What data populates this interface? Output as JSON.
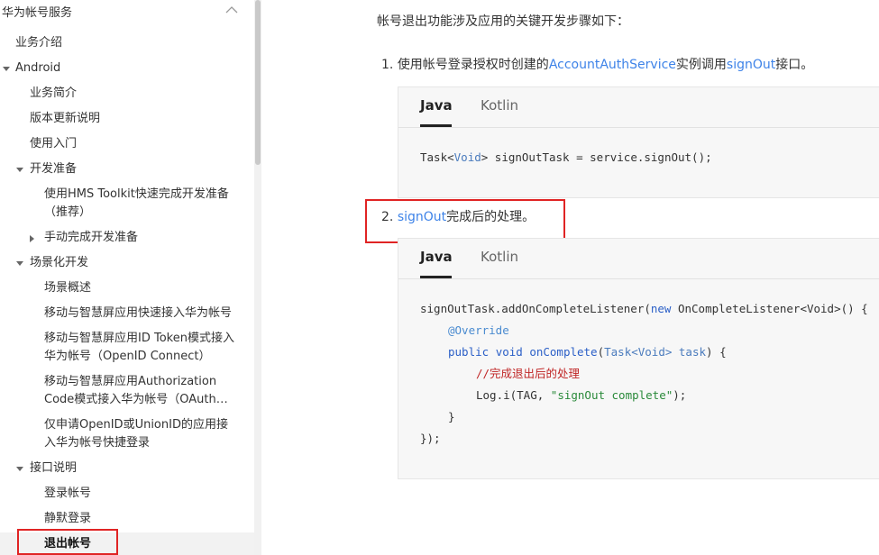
{
  "sidebar": {
    "title": "华为帐号服务",
    "items": [
      {
        "label": "业务介绍"
      },
      {
        "label": "Android"
      },
      {
        "label": "业务简介"
      },
      {
        "label": "版本更新说明"
      },
      {
        "label": "使用入门"
      },
      {
        "label": "开发准备"
      },
      {
        "label": "使用HMS Toolkit快速完成开发准备"
      },
      {
        "label": "（推荐）"
      },
      {
        "label": "手动完成开发准备"
      },
      {
        "label": "场景化开发"
      },
      {
        "label": "场景概述"
      },
      {
        "label": "移动与智慧屏应用快速接入华为帐号"
      },
      {
        "label": "移动与智慧屏应用ID Token模式接入"
      },
      {
        "label": "华为帐号（OpenID Connect）"
      },
      {
        "label": "移动与智慧屏应用Authorization"
      },
      {
        "label": "Code模式接入华为帐号（OAuth…"
      },
      {
        "label": "仅申请OpenID或UnionID的应用接"
      },
      {
        "label": "入华为帐号快捷登录"
      },
      {
        "label": "接口说明"
      },
      {
        "label": "登录帐号"
      },
      {
        "label": "静默登录"
      },
      {
        "label": "退出帐号"
      }
    ]
  },
  "content": {
    "intro": "帐号退出功能涉及应用的关键开发步骤如下：",
    "step1": {
      "num": "1.",
      "pre": "使用帐号登录授权时创建的",
      "link1": "AccountAuthService",
      "mid": "实例调用",
      "link2": "signOut",
      "post": "接口。"
    },
    "step2": {
      "num": "2.",
      "link": "signOut",
      "post": "完成后的处理。"
    },
    "tabs": {
      "java": "Java",
      "kotlin": "Kotlin"
    },
    "code1": {
      "p1": "Task<",
      "t1": "Void",
      "p2": "> signOutTask = service.signOut();"
    },
    "code2": {
      "l1a": "signOutTask.addOnCompleteListener(",
      "l1kw": "new",
      "l1b": " OnCompleteListener<Void>() {",
      "l2": "@Override",
      "l3kw1": "public",
      "l3kw2": "void",
      "l3fn": "onComplete",
      "l3a": "(",
      "l3t": "Task<Void> task",
      "l3b": ") {",
      "l4": "//完成退出后的处理",
      "l5a": "Log.i(TAG, ",
      "l5s": "\"signOut complete\"",
      "l5b": ");",
      "l6": "}",
      "l7": "});"
    }
  },
  "colors": {
    "link": "#3e83e8",
    "highlight": "#e02424",
    "keyword": "#2b5fc7",
    "comment": "#c02626",
    "string": "#2a8a3a"
  }
}
